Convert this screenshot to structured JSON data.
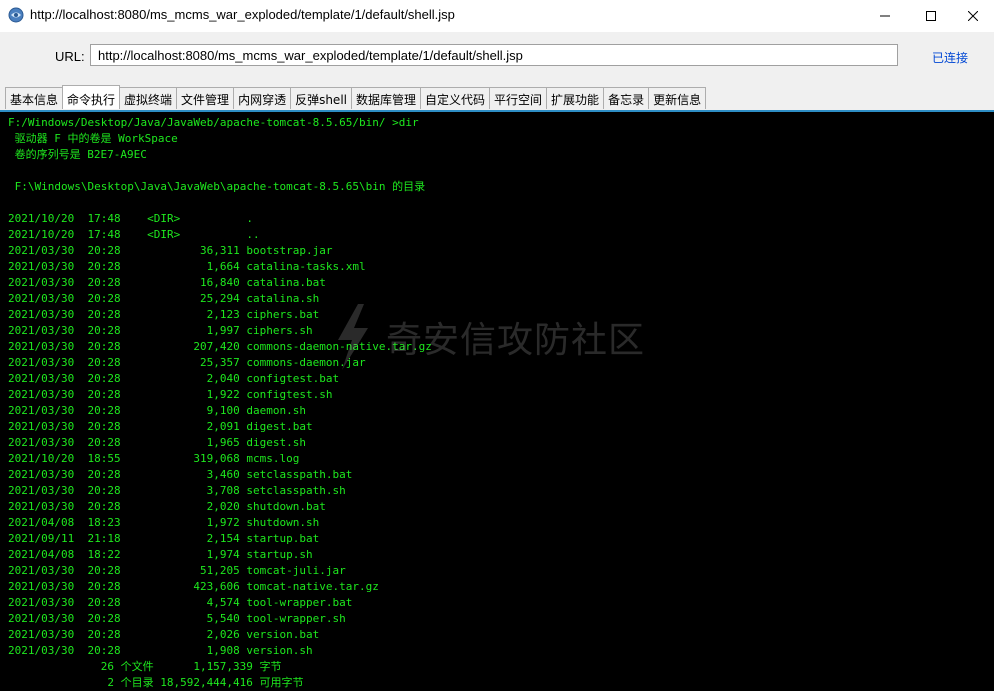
{
  "window": {
    "title": "http://localhost:8080/ms_mcms_war_exploded/template/1/default/shell.jsp"
  },
  "urlbar": {
    "label": "URL:",
    "value": "http://localhost:8080/ms_mcms_war_exploded/template/1/default/shell.jsp",
    "status": "已连接"
  },
  "tabs": [
    {
      "label": "基本信息"
    },
    {
      "label": "命令执行"
    },
    {
      "label": "虚拟终端"
    },
    {
      "label": "文件管理"
    },
    {
      "label": "内网穿透"
    },
    {
      "label": "反弹shell"
    },
    {
      "label": "数据库管理"
    },
    {
      "label": "自定义代码"
    },
    {
      "label": "平行空间"
    },
    {
      "label": "扩展功能"
    },
    {
      "label": "备忘录"
    },
    {
      "label": "更新信息"
    }
  ],
  "active_tab": "命令执行",
  "console": {
    "output": "F:/Windows/Desktop/Java/JavaWeb/apache-tomcat-8.5.65/bin/ >dir\n 驱动器 F 中的卷是 WorkSpace\n 卷的序列号是 B2E7-A9EC\n\n F:\\Windows\\Desktop\\Java\\JavaWeb\\apache-tomcat-8.5.65\\bin 的目录\n\n2021/10/20  17:48    <DIR>          .\n2021/10/20  17:48    <DIR>          ..\n2021/03/30  20:28            36,311 bootstrap.jar\n2021/03/30  20:28             1,664 catalina-tasks.xml\n2021/03/30  20:28            16,840 catalina.bat\n2021/03/30  20:28            25,294 catalina.sh\n2021/03/30  20:28             2,123 ciphers.bat\n2021/03/30  20:28             1,997 ciphers.sh\n2021/03/30  20:28           207,420 commons-daemon-native.tar.gz\n2021/03/30  20:28            25,357 commons-daemon.jar\n2021/03/30  20:28             2,040 configtest.bat\n2021/03/30  20:28             1,922 configtest.sh\n2021/03/30  20:28             9,100 daemon.sh\n2021/03/30  20:28             2,091 digest.bat\n2021/03/30  20:28             1,965 digest.sh\n2021/10/20  18:55           319,068 mcms.log\n2021/03/30  20:28             3,460 setclasspath.bat\n2021/03/30  20:28             3,708 setclasspath.sh\n2021/03/30  20:28             2,020 shutdown.bat\n2021/04/08  18:23             1,972 shutdown.sh\n2021/09/11  21:18             2,154 startup.bat\n2021/04/08  18:22             1,974 startup.sh\n2021/03/30  20:28            51,205 tomcat-juli.jar\n2021/03/30  20:28           423,606 tomcat-native.tar.gz\n2021/03/30  20:28             4,574 tool-wrapper.bat\n2021/03/30  20:28             5,540 tool-wrapper.sh\n2021/03/30  20:28             2,026 version.bat\n2021/03/30  20:28             1,908 version.sh\n              26 个文件      1,157,339 字节\n               2 个目录 18,592,444,416 可用字节"
  },
  "watermark": {
    "text": "奇安信攻防社区"
  },
  "colors": {
    "console_bg": "#000000",
    "console_text": "#1ee81e",
    "link": "#0047d4",
    "accent": "#2d8dc4"
  }
}
